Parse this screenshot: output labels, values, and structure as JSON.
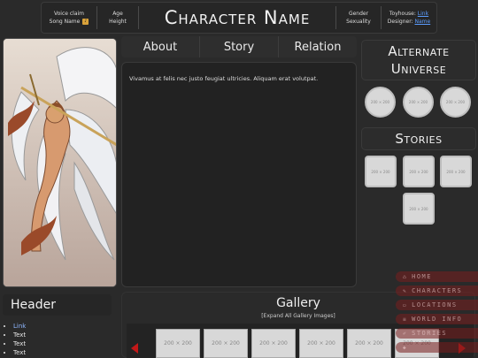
{
  "header": {
    "voice_claim": "Voice claim",
    "song_name": "Song Name",
    "music_icon": "music-note-icon",
    "age": "Age",
    "height": "Height",
    "character_name": "Character Name",
    "gender": "Gender",
    "sexuality": "Sexuality",
    "toyhouse_label": "Toyhouse:",
    "toyhouse_link": "Link",
    "designer_label": "Designer:",
    "designer_link": "Name"
  },
  "tabs": [
    "About",
    "Story",
    "Relation"
  ],
  "content": {
    "text": "Vivamus at felis nec justo feugiat ultricies. Aliquam erat volutpat."
  },
  "alternate_universe": {
    "title": "Alternate Universe",
    "items": [
      "200 × 200",
      "200 × 200",
      "200 × 200"
    ]
  },
  "stories": {
    "title": "Stories",
    "items": [
      "200 × 200",
      "200 × 200",
      "200 × 200",
      "200 × 200"
    ]
  },
  "sidebar_header": {
    "title": "Header",
    "items": [
      "Link",
      "Text",
      "Text",
      "Text"
    ]
  },
  "gallery": {
    "title": "Gallery",
    "expand": "[Expand All Gallery Images]",
    "thumbs": [
      "200 × 200",
      "200 × 200",
      "200 × 200",
      "200 × 200",
      "200 × 200",
      "200 × 200"
    ]
  },
  "nav": [
    {
      "icon": "home-icon",
      "label": "Home"
    },
    {
      "icon": "characters-icon",
      "label": "Characters"
    },
    {
      "icon": "locations-icon",
      "label": "Locations"
    },
    {
      "icon": "world-info-icon",
      "label": "World Info"
    },
    {
      "icon": "stories-icon",
      "label": "Stories"
    },
    {
      "icon": "extra-icon",
      "label": ""
    }
  ],
  "colors": {
    "background": "#2a2a2a",
    "panel": "#2f2f2f",
    "link": "#5b9dff",
    "nav_accent": "#7a1e1e",
    "arrow": "#c21818"
  }
}
